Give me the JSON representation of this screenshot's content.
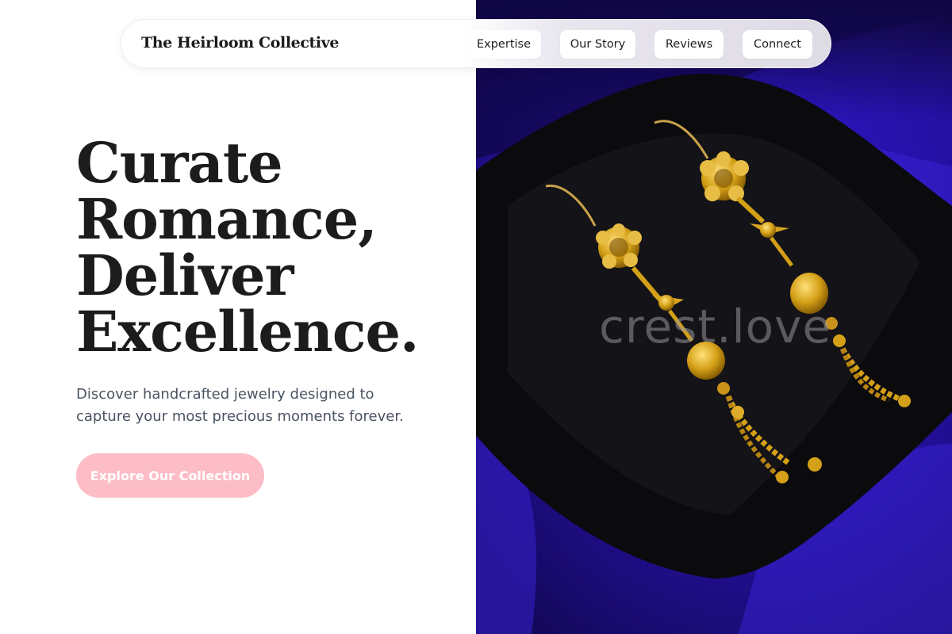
{
  "brand": {
    "name": "The Heirloom Collective"
  },
  "nav": {
    "links": [
      {
        "label": "Expertise"
      },
      {
        "label": "Our Story"
      },
      {
        "label": "Reviews"
      },
      {
        "label": "Connect"
      }
    ]
  },
  "hero": {
    "headline_lines": [
      "Curate",
      "Romance,",
      "Deliver",
      "Excellence."
    ],
    "subtext": "Discover handcrafted jewelry designed to capture your most precious moments forever.",
    "cta_label": "Explore Our Collection"
  },
  "image": {
    "watermark": "crest.love",
    "subject": "gold-drop-earrings-on-black-velvet"
  },
  "colors": {
    "cta_background": "#fdbdc7",
    "headline": "#1c1c1c",
    "velvet_blue": "#2a12a8",
    "gold": "#d4a017"
  }
}
